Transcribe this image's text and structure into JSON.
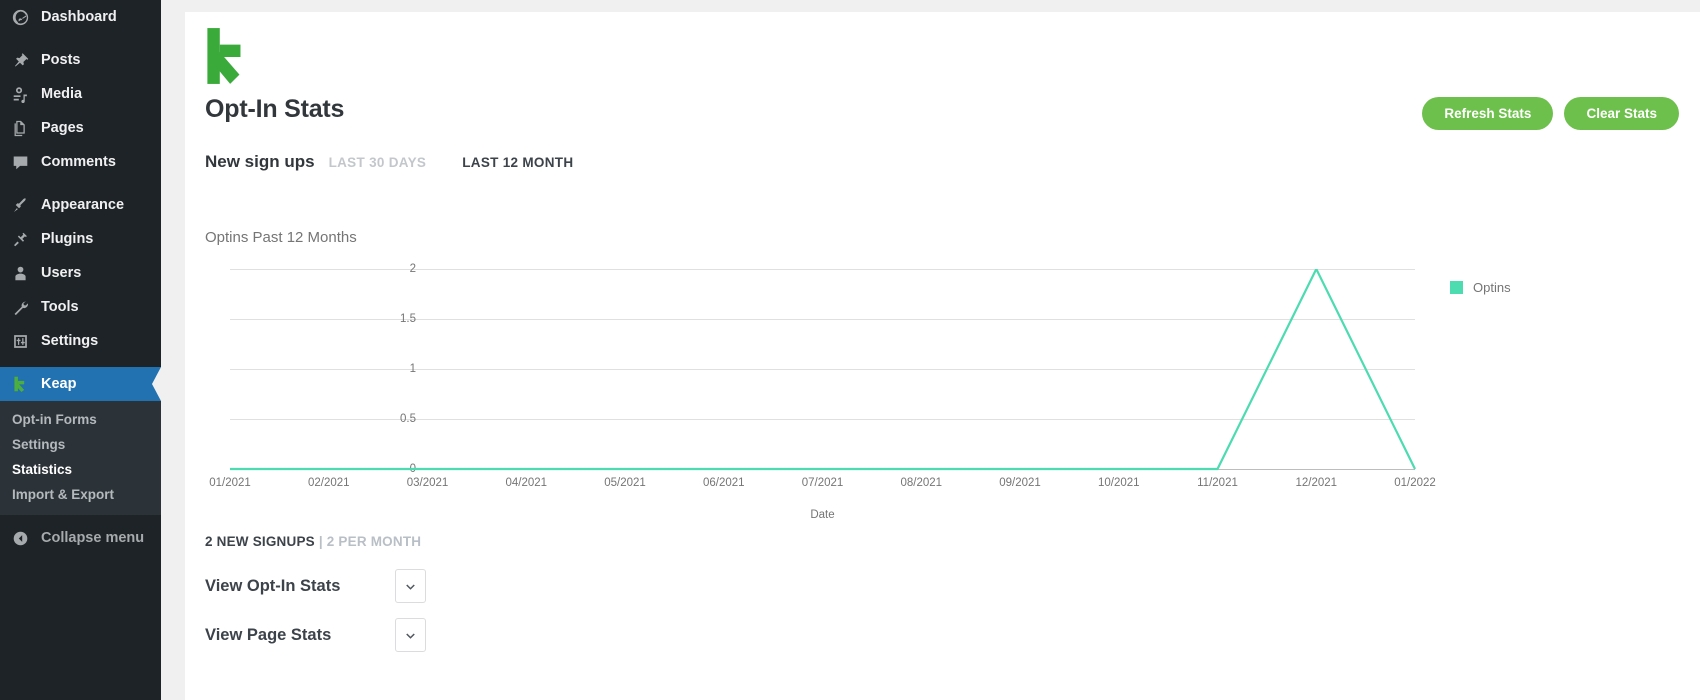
{
  "sidebar": {
    "items": [
      {
        "label": "Dashboard",
        "icon": "dashboard-icon"
      },
      {
        "label": "Posts",
        "icon": "pin-icon"
      },
      {
        "label": "Media",
        "icon": "media-icon"
      },
      {
        "label": "Pages",
        "icon": "pages-icon"
      },
      {
        "label": "Comments",
        "icon": "comment-icon"
      },
      {
        "label": "Appearance",
        "icon": "paintbrush-icon"
      },
      {
        "label": "Plugins",
        "icon": "plug-icon"
      },
      {
        "label": "Users",
        "icon": "user-icon"
      },
      {
        "label": "Tools",
        "icon": "wrench-icon"
      },
      {
        "label": "Settings",
        "icon": "sliders-icon"
      },
      {
        "label": "Keap",
        "icon": "keap-logo-icon"
      }
    ],
    "submenu": [
      {
        "label": "Opt-in Forms",
        "active": false
      },
      {
        "label": "Settings",
        "active": false
      },
      {
        "label": "Statistics",
        "active": true
      },
      {
        "label": "Import & Export",
        "active": false
      }
    ],
    "collapse_label": "Collapse menu",
    "collapse_icon": "collapse-arrow-icon",
    "highlight_color": "#2271b1"
  },
  "header": {
    "logo_icon": "keap-logo-icon",
    "logo_color": "#3aab3a",
    "title": "Opt-In Stats",
    "refresh_label": "Refresh Stats",
    "clear_label": "Clear Stats",
    "button_color": "#6dc04b"
  },
  "tabs": {
    "section_label": "New sign ups",
    "items": [
      {
        "label": "LAST 30 DAYS",
        "active": false
      },
      {
        "label": "LAST 12 MONTH",
        "active": true
      }
    ]
  },
  "chart_data": {
    "type": "line",
    "title": "Optins Past 12 Months",
    "xlabel": "Date",
    "ylabel": "",
    "categories": [
      "01/2021",
      "02/2021",
      "03/2021",
      "04/2021",
      "05/2021",
      "06/2021",
      "07/2021",
      "08/2021",
      "09/2021",
      "10/2021",
      "11/2021",
      "12/2021",
      "01/2022"
    ],
    "series": [
      {
        "name": "Optins",
        "color": "#4ddbb0",
        "values": [
          0,
          0,
          0,
          0,
          0,
          0,
          0,
          0,
          0,
          0,
          0,
          2,
          0
        ]
      }
    ],
    "yticks": [
      "2",
      "1.5",
      "1",
      "0.5",
      "0"
    ],
    "ylim": [
      0,
      2
    ],
    "grid": true,
    "legend": {
      "position": "right",
      "entries": [
        {
          "label": "Optins",
          "color": "#4ddbb0"
        }
      ]
    }
  },
  "summary": {
    "signups": "2 NEW SIGNUPS",
    "divider": "|",
    "per_month": "2 PER MONTH"
  },
  "accordions": [
    {
      "label": "View Opt-In Stats",
      "icon": "chevron-down-icon"
    },
    {
      "label": "View Page Stats",
      "icon": "chevron-down-icon"
    }
  ]
}
